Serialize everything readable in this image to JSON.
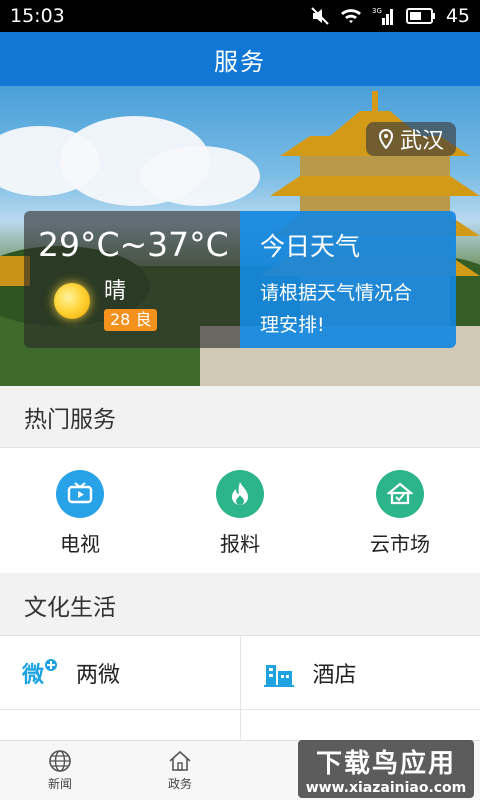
{
  "status_bar": {
    "time": "15:03",
    "battery": "45"
  },
  "header": {
    "title": "服务"
  },
  "hero": {
    "location": "武汉",
    "weather": {
      "temperature": "29°C~37°C",
      "condition": "晴",
      "aqi": "28 良"
    },
    "today": {
      "title": "今日天气",
      "text_line1": "请根据天气情况合",
      "text_line2": "理安排!"
    }
  },
  "hot_services": {
    "title": "热门服务",
    "items": [
      {
        "label": "电视",
        "icon": "tv-icon",
        "color": "#29a3e8"
      },
      {
        "label": "报料",
        "icon": "flame-icon",
        "color": "#2cb58a"
      },
      {
        "label": "云市场",
        "icon": "shop-icon",
        "color": "#2cb58a"
      }
    ]
  },
  "culture": {
    "title": "文化生活",
    "items": [
      {
        "label": "两微",
        "icon": "weibo-weixin-icon"
      },
      {
        "label": "酒店",
        "icon": "hotel-icon"
      }
    ]
  },
  "bottom_nav": {
    "items": [
      {
        "label": "新闻",
        "icon": "globe-icon"
      },
      {
        "label": "政务",
        "icon": "home-icon"
      }
    ]
  },
  "watermark": {
    "title": "下载鸟应用",
    "url": "www.xiazainiao.com"
  },
  "colors": {
    "brand_blue": "#1177d5",
    "card_blue": "#1387e1",
    "aqi_orange": "#f5921e"
  }
}
